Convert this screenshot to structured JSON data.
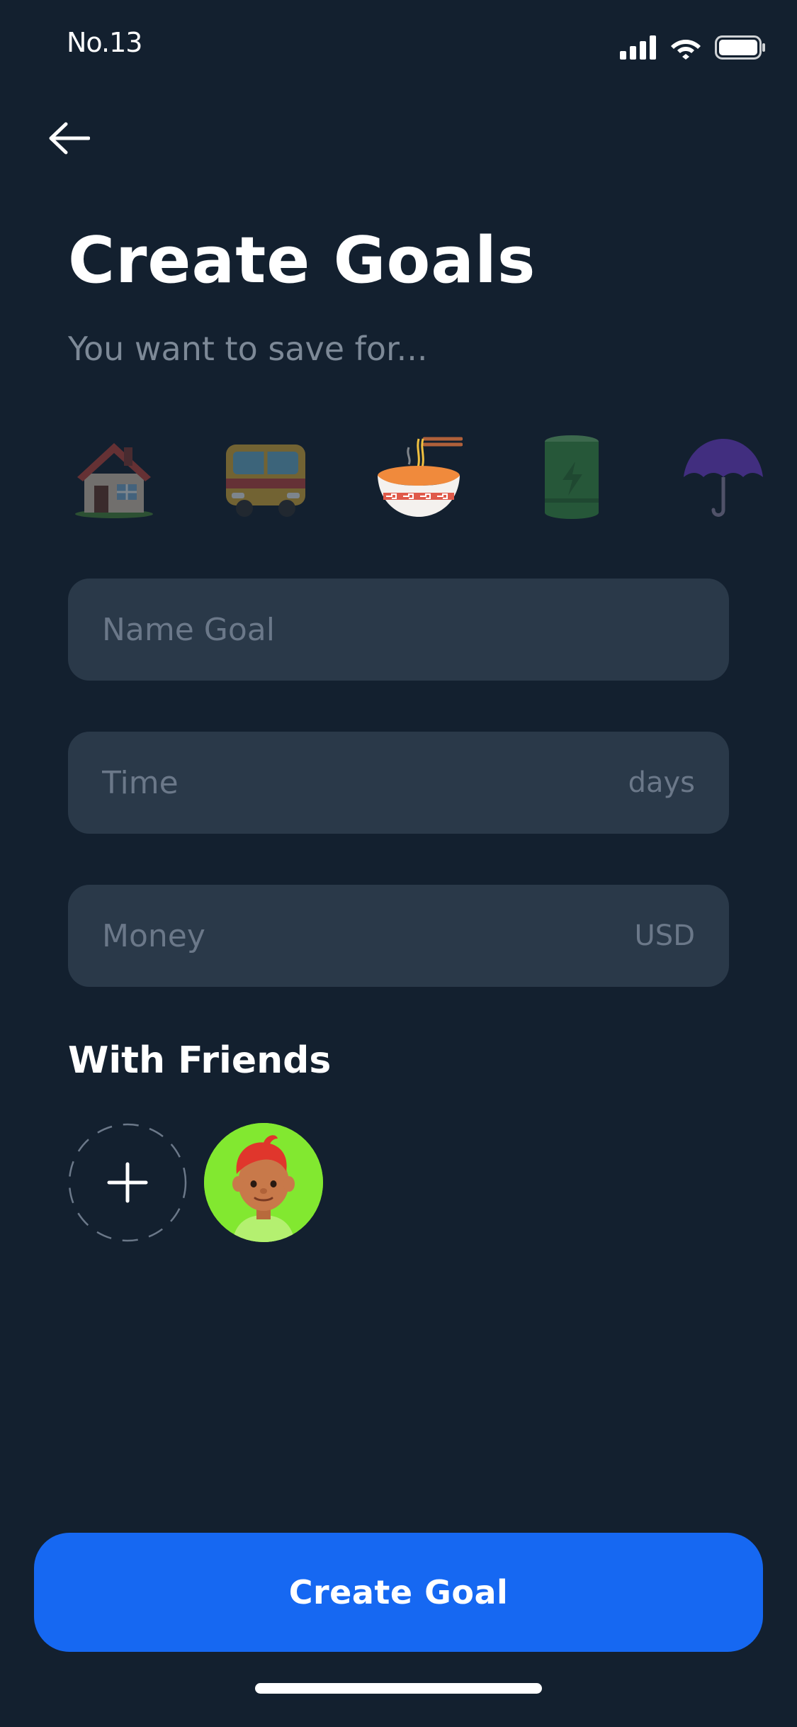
{
  "status_bar": {
    "time": "No.13"
  },
  "header": {
    "back_icon": "arrow-left-icon",
    "title": "Create Goals",
    "subtitle": "You want to save for..."
  },
  "categories": [
    {
      "icon": "house-icon",
      "selected": false
    },
    {
      "icon": "bus-icon",
      "selected": false
    },
    {
      "icon": "noodle-bowl-icon",
      "selected": true
    },
    {
      "icon": "battery-icon",
      "selected": false
    },
    {
      "icon": "umbrella-icon",
      "selected": false
    }
  ],
  "form": {
    "name_placeholder": "Name Goal",
    "time_placeholder": "Time",
    "time_unit": "days",
    "money_placeholder": "Money",
    "money_unit": "USD"
  },
  "friends": {
    "title": "With Friends",
    "add_icon": "plus-icon",
    "avatar_icon": "friend-avatar-icon"
  },
  "actions": {
    "create_label": "Create Goal"
  },
  "colors": {
    "background": "#13202f",
    "field": "#2a3949",
    "primary": "#1668f2",
    "avatar_bg": "#82e830"
  }
}
